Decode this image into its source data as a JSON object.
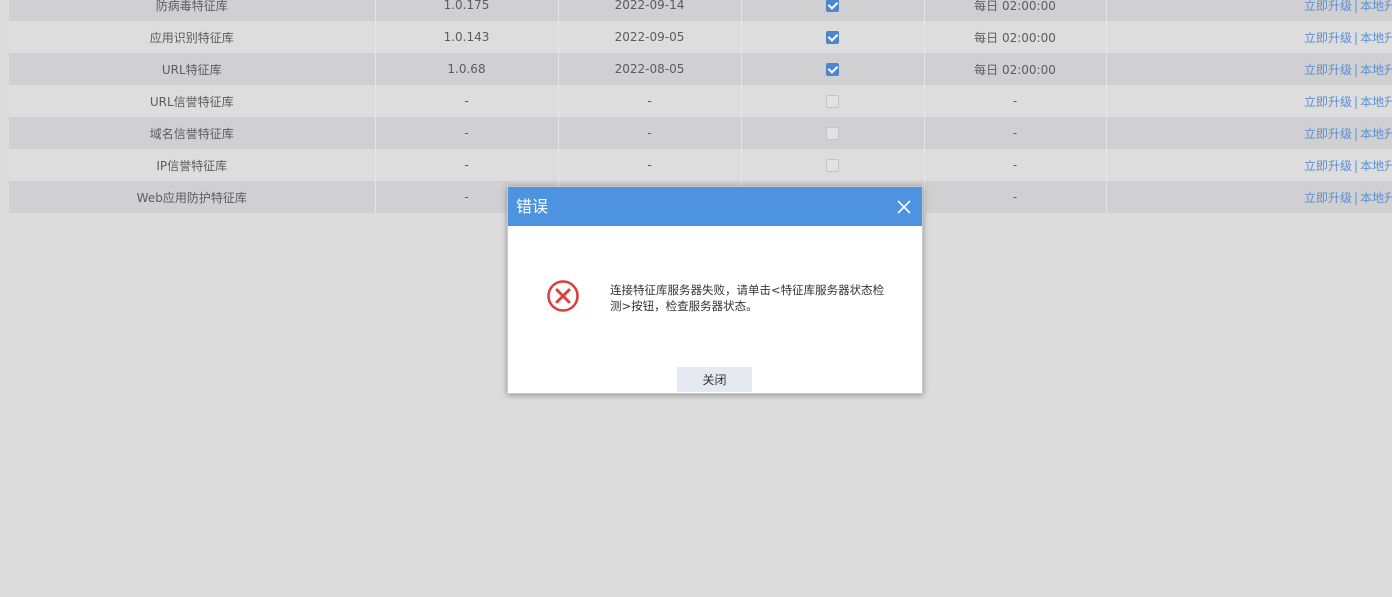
{
  "table": {
    "rows": [
      {
        "name": "防病毒特征库",
        "version": "1.0.175",
        "date": "2022-09-14",
        "auto_update": true,
        "schedule": "每日 02:00:00"
      },
      {
        "name": "应用识别特征库",
        "version": "1.0.143",
        "date": "2022-09-05",
        "auto_update": true,
        "schedule": "每日 02:00:00"
      },
      {
        "name": "URL特征库",
        "version": "1.0.68",
        "date": "2022-08-05",
        "auto_update": true,
        "schedule": "每日 02:00:00"
      },
      {
        "name": "URL信誉特征库",
        "version": "-",
        "date": "-",
        "auto_update": false,
        "schedule": "-"
      },
      {
        "name": "域名信誉特征库",
        "version": "-",
        "date": "-",
        "auto_update": false,
        "schedule": "-"
      },
      {
        "name": "IP信誉特征库",
        "version": "-",
        "date": "-",
        "auto_update": false,
        "schedule": "-"
      },
      {
        "name": "Web应用防护特征库",
        "version": "-",
        "date": "",
        "auto_update": null,
        "schedule": "-"
      }
    ],
    "op_upgrade": "立即升级",
    "op_sep": "|",
    "op_local": "本地升级"
  },
  "dialog": {
    "title": "错误",
    "message": "连接特征库服务器失败，请单击<特征库服务器状态检测>按钮，检查服务器状态。",
    "close_button": "关闭",
    "icon": "error-circle-icon",
    "header_color": "#4e93e0",
    "error_color": "#d94040"
  }
}
